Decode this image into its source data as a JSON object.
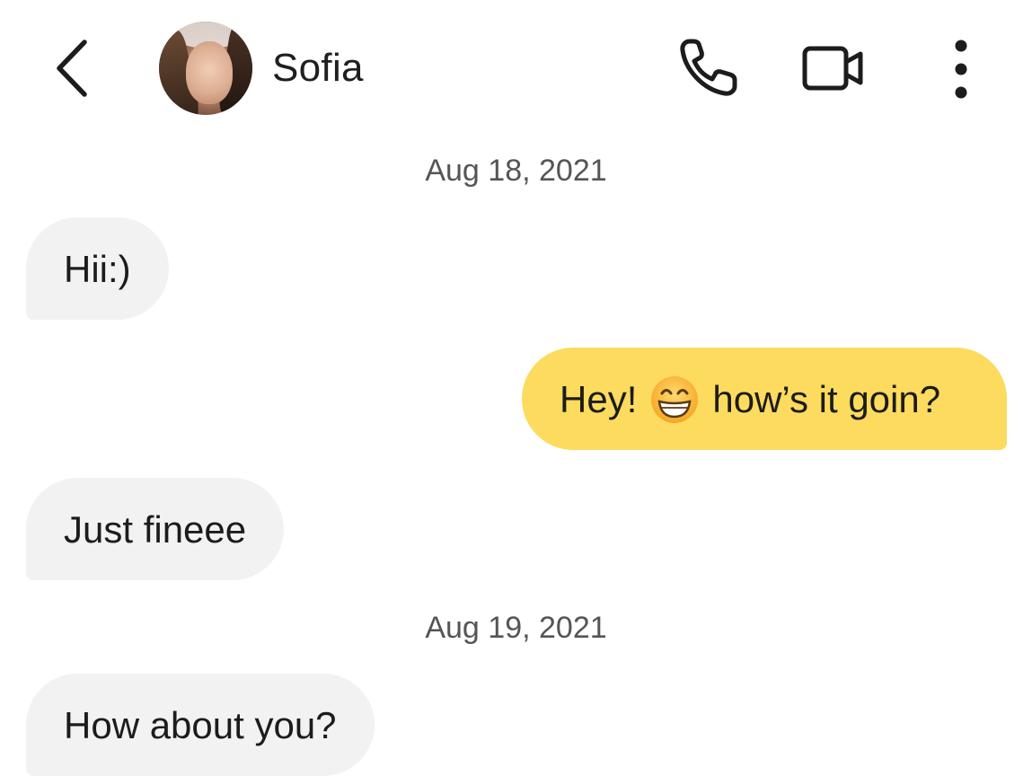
{
  "header": {
    "contact_name": "Sofia",
    "actions": [
      "back-icon",
      "phone-icon",
      "video-icon",
      "more-vertical-icon"
    ]
  },
  "messages": [
    {
      "type": "date",
      "text": "Aug 18, 2021"
    },
    {
      "type": "incoming",
      "text": "Hii:)"
    },
    {
      "type": "outgoing",
      "text_before": "Hey!",
      "emoji": "grinning-face-with-smiling-eyes",
      "text_after": "how’s it goin?"
    },
    {
      "type": "incoming",
      "text": "Just fineee"
    },
    {
      "type": "date",
      "text": "Aug 19, 2021"
    },
    {
      "type": "incoming",
      "text": "How about you?"
    }
  ],
  "colors": {
    "incoming_bubble": "#f2f2f2",
    "outgoing_bubble": "#fcdb5e",
    "text": "#1c1c1c",
    "date_text": "#555555"
  }
}
